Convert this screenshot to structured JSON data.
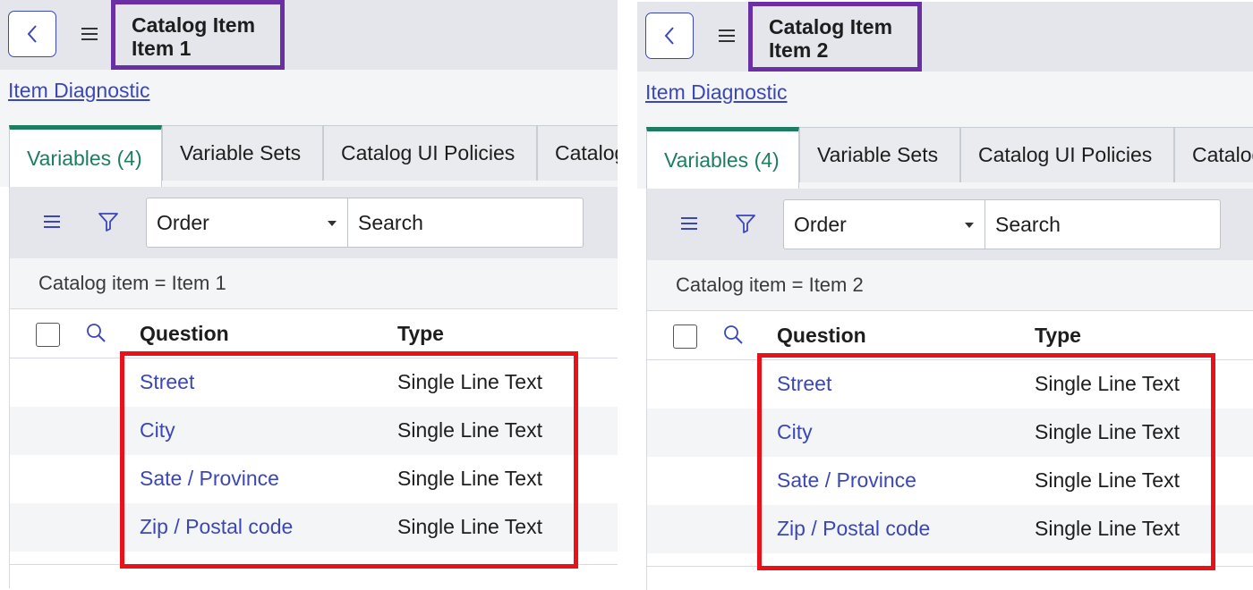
{
  "panels": [
    {
      "title_line1": "Catalog Item",
      "title_line2": "Item 1",
      "diagnostic_link": "Item Diagnostic",
      "tabs": [
        "Variables (4)",
        "Variable Sets",
        "Catalog UI Policies",
        "Catalog"
      ],
      "order_select": "Order",
      "search_placeholder": "Search",
      "breadcrumb": "Catalog item = Item 1",
      "columns": [
        "Question",
        "Type"
      ],
      "rows": [
        {
          "question": "Street",
          "type": "Single Line Text"
        },
        {
          "question": "City",
          "type": "Single Line Text"
        },
        {
          "question": "Sate / Province",
          "type": "Single Line Text"
        },
        {
          "question": "Zip / Postal code",
          "type": "Single Line Text"
        }
      ]
    },
    {
      "title_line1": "Catalog Item",
      "title_line2": "Item 2",
      "diagnostic_link": "Item Diagnostic",
      "tabs": [
        "Variables (4)",
        "Variable Sets",
        "Catalog UI Policies",
        "Catalog"
      ],
      "order_select": "Order",
      "search_placeholder": "Search",
      "breadcrumb": "Catalog item = Item 2",
      "columns": [
        "Question",
        "Type"
      ],
      "rows": [
        {
          "question": "Street",
          "type": "Single Line Text"
        },
        {
          "question": "City",
          "type": "Single Line Text"
        },
        {
          "question": "Sate / Province",
          "type": "Single Line Text"
        },
        {
          "question": "Zip / Postal code",
          "type": "Single Line Text"
        }
      ]
    }
  ],
  "icons": {
    "back": "chevron-left-icon",
    "menu": "hamburger-menu-icon",
    "list_menu": "list-menu-icon",
    "filter": "filter-funnel-icon",
    "column_search": "search-icon"
  },
  "colors": {
    "title_highlight": "#6a2fa5",
    "rows_highlight": "#e8131a",
    "active_tab": "#1c7d62",
    "link": "#3b47b8"
  }
}
